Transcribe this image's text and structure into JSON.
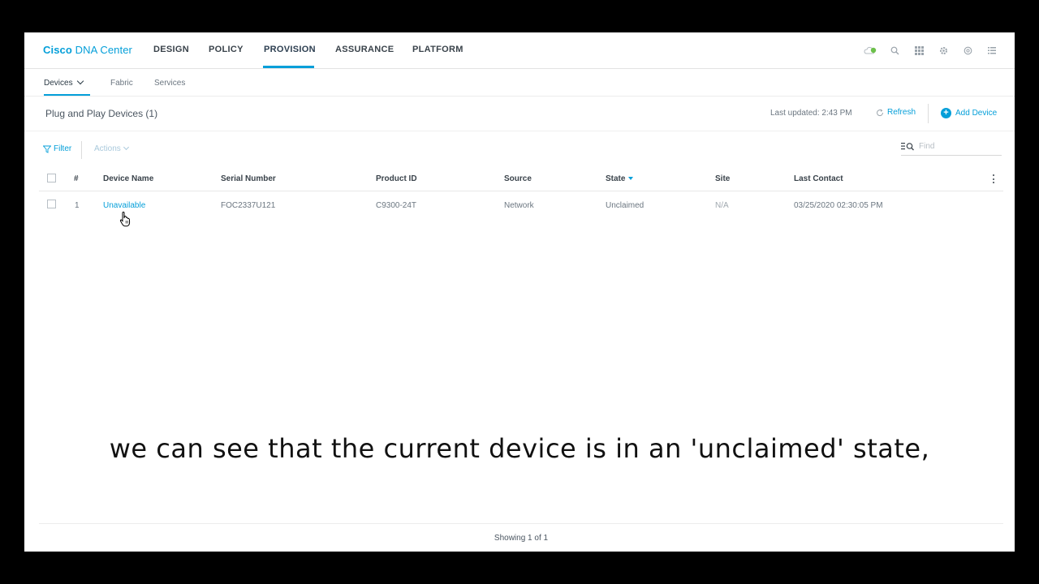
{
  "app": {
    "brand_bold": "Cisco",
    "brand_light": "DNA Center"
  },
  "topnav": {
    "items": [
      "DESIGN",
      "POLICY",
      "PROVISION",
      "ASSURANCE",
      "PLATFORM"
    ],
    "active": "PROVISION",
    "icons": [
      "cloud-status-icon",
      "search-icon",
      "apps-grid-icon",
      "gear-icon",
      "help-icon",
      "menu-icon"
    ],
    "status_color": "#6cc04a"
  },
  "subnav": {
    "items": [
      "Devices",
      "Fabric",
      "Services"
    ],
    "active": "Devices"
  },
  "header": {
    "title": "Plug and Play Devices (1)",
    "last_updated": "Last updated: 2:43 PM",
    "refresh_label": "Refresh",
    "add_device_label": "Add Device"
  },
  "toolbar": {
    "filter_label": "Filter",
    "actions_label": "Actions",
    "find_placeholder": "Find"
  },
  "table": {
    "columns": [
      "#",
      "Device Name",
      "Serial Number",
      "Product ID",
      "Source",
      "State",
      "Site",
      "Last Contact"
    ],
    "sorted_column": "State",
    "rows": [
      {
        "index": "1",
        "device_name": "Unavailable",
        "serial_number": "FOC2337U121",
        "product_id": "C9300-24T",
        "source": "Network",
        "state": "Unclaimed",
        "site": "N/A",
        "last_contact": "03/25/2020 02:30:05 PM"
      }
    ]
  },
  "footer": {
    "showing": "Showing 1 of 1"
  },
  "caption": "we can see that the current device is in an 'unclaimed' state,",
  "colors": {
    "accent": "#049fd9",
    "text_dark": "#39424a",
    "text_muted": "#6b7680"
  }
}
